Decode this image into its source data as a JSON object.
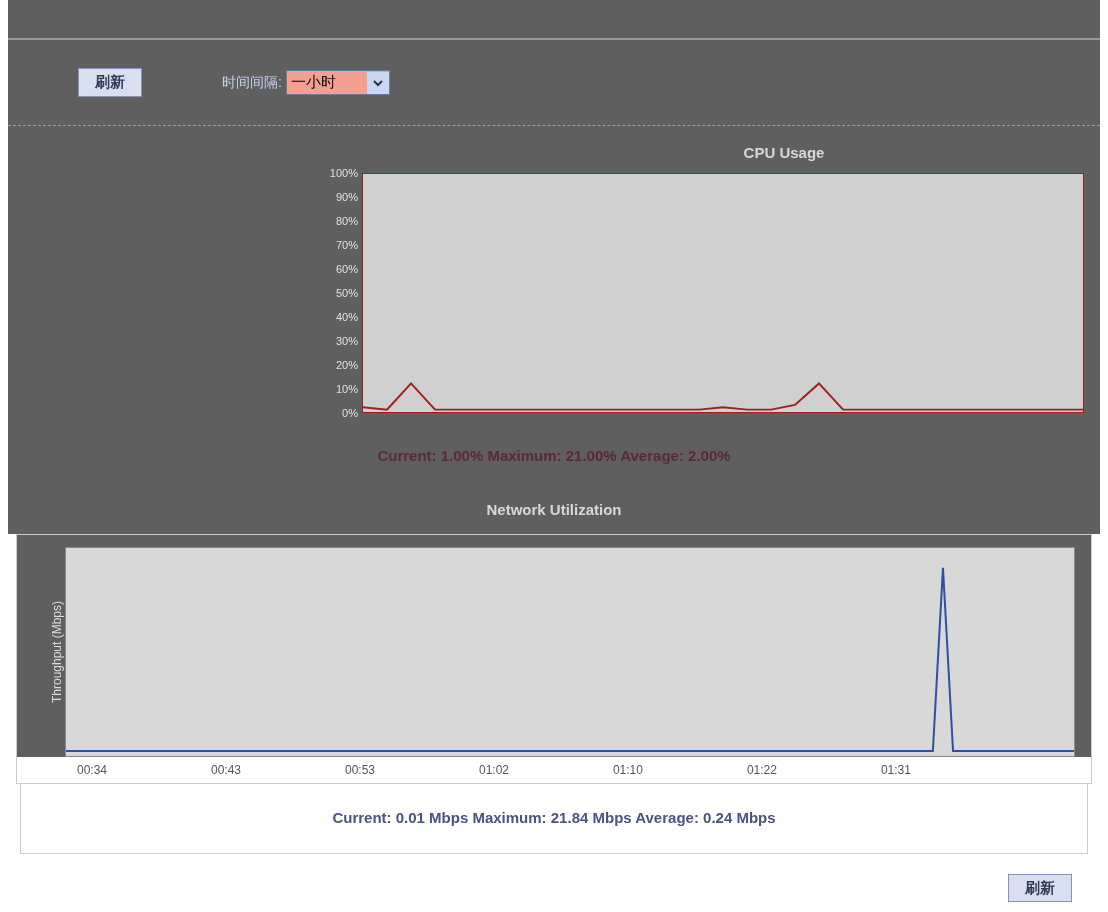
{
  "toolbar": {
    "refresh_button": "刷新",
    "interval_label": "时间间隔:",
    "interval_select": "一小时"
  },
  "cpu_chart": {
    "title": "CPU Usage",
    "chart_data": {
      "type": "line",
      "ylim": [
        0,
        100
      ],
      "yticks": [
        {
          "value": 100,
          "label": "100%"
        },
        {
          "value": 90,
          "label": "90%"
        },
        {
          "value": 80,
          "label": "80%"
        },
        {
          "value": 70,
          "label": "70%"
        },
        {
          "value": 60,
          "label": "60%"
        },
        {
          "value": 50,
          "label": "50%"
        },
        {
          "value": 40,
          "label": "40%"
        },
        {
          "value": 30,
          "label": "30%"
        },
        {
          "value": 20,
          "label": "20%"
        },
        {
          "value": 10,
          "label": "10%"
        },
        {
          "value": 0,
          "label": "0%"
        }
      ],
      "series": [
        {
          "color": "#a02020",
          "values": [
            2,
            1,
            12,
            1,
            1,
            1,
            1,
            1,
            1,
            1,
            1,
            1,
            1,
            1,
            1,
            2,
            1,
            1,
            3,
            12,
            1,
            1,
            1,
            1,
            1,
            1,
            1,
            1,
            1,
            1,
            1
          ]
        }
      ]
    },
    "summary": "Current: 1.00% Maximum: 21.00% Average: 2.00%"
  },
  "network_chart": {
    "title": "Network Utilization",
    "ylabel": "Throughput (Mbps)",
    "xticks": [
      "00:34",
      "00:43",
      "00:53",
      "01:02",
      "01:10",
      "01:22",
      "01:31"
    ],
    "summary": "Current: 0.01 Mbps Maximum: 21.84 Mbps Average: 0.24 Mbps"
  },
  "footer": {
    "refresh_button": "刷新"
  }
}
